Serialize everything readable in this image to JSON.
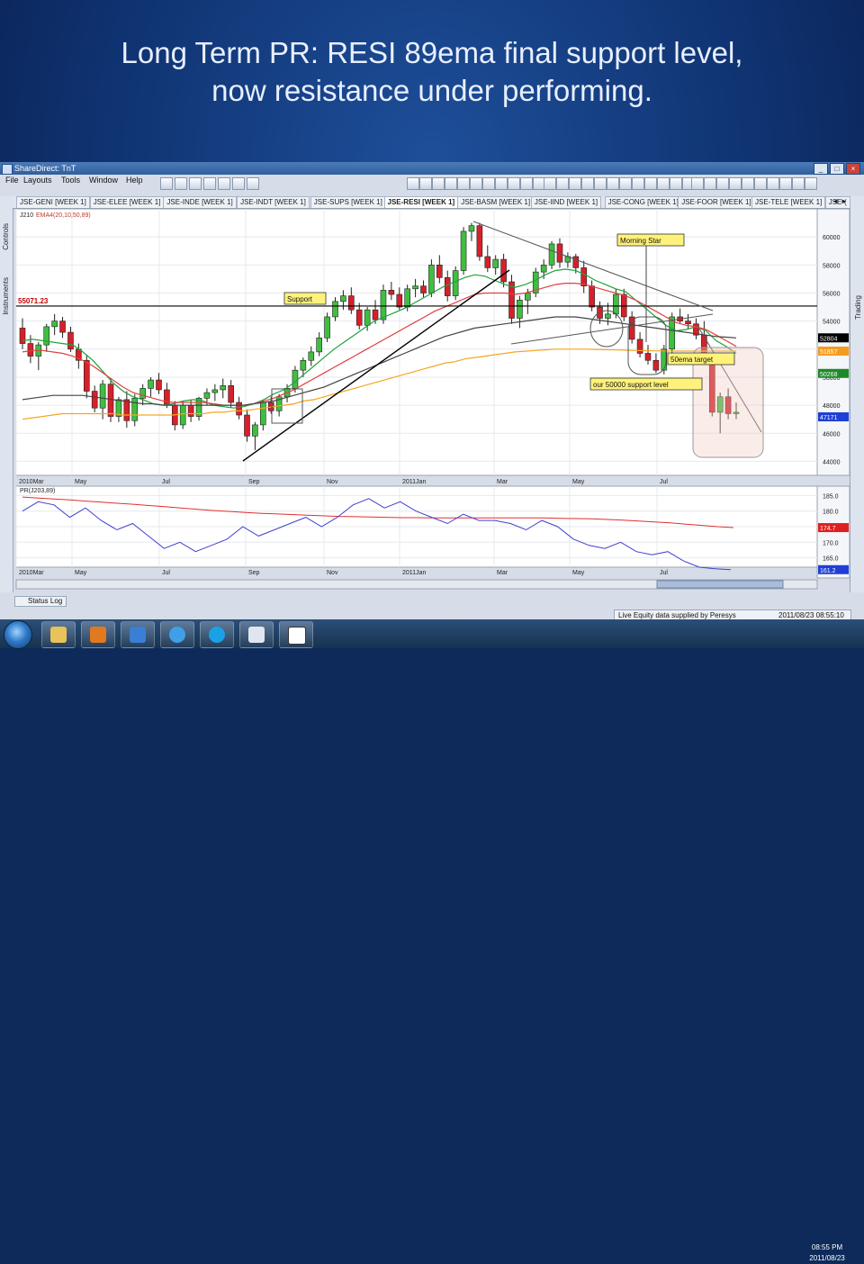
{
  "slide": {
    "title_line1": "Long Term PR: RESI 89ema final support level,",
    "title_line2": "now resistance under performing."
  },
  "app": {
    "title": "ShareDirect: TnT",
    "menu": [
      "File",
      "Layouts",
      "Tools",
      "Window",
      "Help"
    ],
    "left_panels": [
      "Controls",
      "Instruments"
    ],
    "right_panels": [
      "Trading"
    ],
    "tabs": [
      "JSE-GENI [WEEK 1]",
      "JSE-ELEE [WEEK 1]",
      "JSE-INDE [WEEK 1]",
      "JSE-INDT [WEEK 1]",
      "JSE-SUPS [WEEK 1]",
      "JSE-RESI [WEEK 1]",
      "JSE-BASM [WEEK 1]",
      "JSE-IIND [WEEK 1]",
      "JSE-CONG [WEEK 1]",
      "JSE-FOOR [WEEK 1]",
      "JSE-TELE [WEEK 1]",
      "JSE-("
    ],
    "active_tab_index": 5,
    "status_log": "Status Log",
    "data_supplier": "Live Equity data supplied by Peresys",
    "data_timestamp": "2011/08/23 08:55:10 PM",
    "clock_time": "08:55 PM",
    "clock_date": "2011/08/23"
  },
  "chart_data": [
    {
      "type": "candlestick",
      "symbol_label": "J210",
      "indicator_label": "EMA4(20,10,50,89)",
      "y_ticks": [
        60000,
        58000,
        56000,
        54000,
        52000,
        50000,
        48000,
        46000,
        44000
      ],
      "x_ticks": [
        "2010Mar",
        "May",
        "Jul",
        "Sep",
        "Nov",
        "2011Jan",
        "Mar",
        "May",
        "Jul"
      ],
      "ylim": [
        43000,
        62000
      ],
      "horizontal_line": {
        "value": 55071.23,
        "label": "55071.23"
      },
      "price_tags": [
        {
          "value": 52804,
          "label": "52804",
          "color": "#000000"
        },
        {
          "value": 51857,
          "label": "51857",
          "color": "#f59b1e"
        },
        {
          "value": 50268,
          "label": "50268",
          "color": "#1f8a2a"
        },
        {
          "value": 47171,
          "label": "47171",
          "color": "#1f3fd6"
        }
      ],
      "annotations": [
        {
          "text": "Support",
          "x": "Oct 2010",
          "y": 55600
        },
        {
          "text": "Morning Star",
          "x": "Jun 2011",
          "y": 59500
        },
        {
          "text": "50ema target",
          "x": "Jul 2011",
          "y": 50800
        },
        {
          "text": "our 50000 support level",
          "x": "May 2011",
          "y": 49800
        }
      ],
      "candles": [
        [
          53500,
          54200,
          52000,
          52400
        ],
        [
          52400,
          53000,
          51000,
          51500
        ],
        [
          51500,
          52500,
          50500,
          52300
        ],
        [
          52300,
          53800,
          51800,
          53600
        ],
        [
          53600,
          54500,
          53000,
          54000
        ],
        [
          54000,
          54300,
          52800,
          53200
        ],
        [
          53200,
          53600,
          51800,
          52000
        ],
        [
          52000,
          52400,
          50600,
          51200
        ],
        [
          51200,
          51600,
          48500,
          49000
        ],
        [
          49000,
          49400,
          47500,
          47800
        ],
        [
          47800,
          49800,
          47000,
          49500
        ],
        [
          49500,
          49900,
          46800,
          47200
        ],
        [
          47200,
          48600,
          46800,
          48400
        ],
        [
          48400,
          49000,
          46400,
          46900
        ],
        [
          46900,
          48800,
          46500,
          48500
        ],
        [
          48500,
          49500,
          48000,
          49200
        ],
        [
          49200,
          50000,
          48600,
          49800
        ],
        [
          49800,
          50300,
          48800,
          49100
        ],
        [
          49100,
          49600,
          47800,
          48000
        ],
        [
          48000,
          48300,
          46200,
          46600
        ],
        [
          46600,
          48300,
          46300,
          48000
        ],
        [
          48000,
          48400,
          46800,
          47200
        ],
        [
          47200,
          48600,
          46900,
          48500
        ],
        [
          48500,
          49200,
          48000,
          48900
        ],
        [
          48900,
          49500,
          48300,
          49100
        ],
        [
          49100,
          49900,
          48500,
          49400
        ],
        [
          49400,
          49800,
          47800,
          48200
        ],
        [
          48200,
          48600,
          47000,
          47300
        ],
        [
          47300,
          47700,
          45400,
          45800
        ],
        [
          45800,
          46800,
          44800,
          46600
        ],
        [
          46600,
          48400,
          46200,
          48200
        ],
        [
          48200,
          48600,
          47400,
          47600
        ],
        [
          47600,
          48800,
          47200,
          48600
        ],
        [
          48600,
          49500,
          48200,
          49200
        ],
        [
          49200,
          50800,
          48900,
          50500
        ],
        [
          50500,
          51400,
          50000,
          51200
        ],
        [
          51200,
          52200,
          50800,
          51800
        ],
        [
          51800,
          53200,
          51500,
          52800
        ],
        [
          52800,
          54600,
          52500,
          54300
        ],
        [
          54300,
          55700,
          54000,
          55400
        ],
        [
          55400,
          56200,
          54800,
          55800
        ],
        [
          55800,
          56400,
          54500,
          54800
        ],
        [
          54800,
          55300,
          53400,
          53700
        ],
        [
          53700,
          55000,
          53300,
          54800
        ],
        [
          54800,
          55500,
          53800,
          54100
        ],
        [
          54100,
          56600,
          53800,
          56200
        ],
        [
          56200,
          56800,
          55500,
          55900
        ],
        [
          55900,
          56400,
          54800,
          55000
        ],
        [
          55000,
          56600,
          54700,
          56300
        ],
        [
          56300,
          57000,
          55700,
          56500
        ],
        [
          56500,
          56900,
          55700,
          56000
        ],
        [
          56000,
          58400,
          55700,
          58000
        ],
        [
          58000,
          58700,
          56700,
          57100
        ],
        [
          57100,
          57600,
          55400,
          55800
        ],
        [
          55800,
          57900,
          55500,
          57600
        ],
        [
          57600,
          60700,
          57300,
          60400
        ],
        [
          60400,
          61000,
          59700,
          60800
        ],
        [
          60800,
          61000,
          58300,
          58600
        ],
        [
          58600,
          59400,
          57500,
          57800
        ],
        [
          57800,
          58700,
          57300,
          58400
        ],
        [
          58400,
          58800,
          56400,
          56800
        ],
        [
          56800,
          57300,
          53800,
          54200
        ],
        [
          54200,
          55800,
          53500,
          55500
        ],
        [
          55500,
          56300,
          54500,
          56000
        ],
        [
          56000,
          57800,
          55700,
          57500
        ],
        [
          57500,
          58400,
          57000,
          58000
        ],
        [
          58000,
          59700,
          57700,
          59500
        ],
        [
          59500,
          59900,
          57800,
          58200
        ],
        [
          58200,
          58900,
          57800,
          58600
        ],
        [
          58600,
          58800,
          57400,
          57800
        ],
        [
          57800,
          58300,
          56000,
          56500
        ],
        [
          56500,
          56900,
          54700,
          55000
        ],
        [
          55000,
          55400,
          53800,
          54200
        ],
        [
          54200,
          55300,
          53700,
          54500
        ],
        [
          54500,
          56300,
          54200,
          55900
        ],
        [
          55900,
          56300,
          54000,
          54300
        ],
        [
          54300,
          54700,
          52400,
          52700
        ],
        [
          52700,
          53200,
          51400,
          51700
        ],
        [
          51700,
          52300,
          50900,
          51200
        ],
        [
          51200,
          51700,
          50300,
          50500
        ],
        [
          50500,
          52300,
          50200,
          52000
        ],
        [
          52000,
          54600,
          51700,
          54300
        ],
        [
          54300,
          54900,
          53800,
          54000
        ],
        [
          54000,
          54500,
          53400,
          53800
        ],
        [
          53800,
          54200,
          52700,
          53000
        ],
        [
          53000,
          54000,
          51000,
          51300
        ],
        [
          51300,
          51700,
          47200,
          47500
        ],
        [
          47500,
          48900,
          46000,
          48600
        ],
        [
          48600,
          49200,
          47000,
          47400
        ],
        [
          47400,
          48200,
          47000,
          47500
        ]
      ],
      "ema_lines": [
        {
          "name": "EMA 10",
          "color": "#1fa23a",
          "values": [
            52600,
            52700,
            52600,
            52500,
            52400,
            52300,
            51800,
            51200,
            50400,
            49600,
            49000,
            48600,
            48400,
            48100,
            48000,
            48100,
            48300,
            48400,
            48300,
            48000,
            47900,
            47800,
            47900,
            48100,
            48400,
            48800,
            49100,
            49600,
            50200,
            50800,
            51400,
            52000,
            52500,
            53000,
            53500,
            54000,
            54300,
            54600,
            54900,
            55300,
            55700,
            56100,
            56500,
            56800,
            57100,
            57300,
            57200,
            56900,
            56600,
            56400,
            56600,
            56900,
            57300,
            57600,
            57700,
            57600,
            57300,
            56900,
            56600,
            56300,
            56100,
            55500,
            54900,
            54300,
            53700,
            53300,
            53400,
            53600,
            53300,
            52600,
            52200,
            51700
          ]
        },
        {
          "name": "EMA 20",
          "color": "#e04040",
          "values": [
            51800,
            51900,
            51900,
            51800,
            51700,
            51500,
            51200,
            50800,
            50300,
            49800,
            49300,
            48900,
            48700,
            48500,
            48300,
            48200,
            48200,
            48200,
            48200,
            48100,
            48000,
            48000,
            48000,
            48100,
            48300,
            48500,
            48800,
            49100,
            49500,
            49900,
            50300,
            50700,
            51100,
            51500,
            51900,
            52300,
            52700,
            53100,
            53500,
            53900,
            54300,
            54700,
            55000,
            55300,
            55600,
            55900,
            56000,
            56000,
            56000,
            55900,
            56000,
            56200,
            56400,
            56600,
            56700,
            56700,
            56600,
            56400,
            56200,
            56000,
            55800,
            55500,
            55100,
            54700,
            54300,
            53900,
            53700,
            53600,
            53400,
            53000,
            52600,
            52200
          ]
        },
        {
          "name": "EMA 50",
          "color": "#444444",
          "values": [
            48400,
            48500,
            48600,
            48700,
            48700,
            48700,
            48700,
            48600,
            48500,
            48400,
            48300,
            48200,
            48100,
            48100,
            48000,
            48000,
            48000,
            48000,
            48000,
            48000,
            48000,
            48000,
            48000,
            48100,
            48200,
            48300,
            48500,
            48700,
            48900,
            49100,
            49300,
            49600,
            49900,
            50200,
            50500,
            50800,
            51100,
            51400,
            51700,
            52000,
            52300,
            52600,
            52900,
            53100,
            53300,
            53500,
            53600,
            53700,
            53800,
            53900,
            54000,
            54100,
            54200,
            54300,
            54300,
            54300,
            54200,
            54100,
            54000,
            53900,
            53800,
            53700,
            53600,
            53500,
            53400,
            53300,
            53200,
            53100,
            53000,
            52900,
            52850,
            52804
          ]
        },
        {
          "name": "EMA 89",
          "color": "#f5a623",
          "values": [
            47000,
            47100,
            47200,
            47300,
            47400,
            47400,
            47400,
            47400,
            47400,
            47400,
            47300,
            47300,
            47300,
            47300,
            47300,
            47300,
            47400,
            47400,
            47400,
            47500,
            47500,
            47600,
            47600,
            47700,
            47800,
            47900,
            48000,
            48100,
            48300,
            48400,
            48600,
            48800,
            49000,
            49200,
            49400,
            49600,
            49800,
            50000,
            50200,
            50400,
            50600,
            50800,
            51000,
            51100,
            51300,
            51400,
            51500,
            51600,
            51700,
            51800,
            51850,
            51900,
            51950,
            52000,
            52000,
            52000,
            52000,
            51980,
            51960,
            51940,
            51920,
            51900,
            51890,
            51880,
            51870,
            51860,
            51860,
            51858,
            51857,
            51857,
            51857,
            51857
          ]
        }
      ]
    },
    {
      "type": "line",
      "indicator_label": "PR(J203,89)",
      "y_ticks": [
        185.0,
        180.0,
        175.0,
        170.0,
        165.0
      ],
      "ylim": [
        162,
        188
      ],
      "x_ticks": [
        "2010Mar",
        "May",
        "Jul",
        "Sep",
        "Nov",
        "2011Jan",
        "Mar",
        "May",
        "Jul"
      ],
      "price_tags": [
        {
          "value": 174.7,
          "label": "174.7",
          "color": "#e02020"
        },
        {
          "value": 161.2,
          "label": "161.2",
          "color": "#1f3fd6"
        }
      ],
      "series": [
        {
          "name": "",
          "color": "#e03030",
          "values": [
            184.5,
            184.2,
            183.9,
            183.6,
            183.2,
            182.9,
            182.5,
            182.2,
            181.8,
            181.4,
            181.0,
            180.6,
            180.2,
            179.9,
            179.6,
            179.3,
            179.1,
            178.9,
            178.7,
            178.5,
            178.3,
            178.2,
            178.1,
            178.0,
            177.9,
            177.9,
            177.8,
            177.8,
            177.8,
            177.8,
            177.8,
            177.8,
            177.8,
            177.8,
            177.7,
            177.6,
            177.5,
            177.3,
            177.1,
            176.8,
            176.5,
            176.2,
            175.8,
            175.4,
            175.0,
            174.7
          ]
        },
        {
          "name": "",
          "color": "#4040d0",
          "values": [
            180,
            183,
            182,
            178,
            181,
            177,
            174,
            176,
            172,
            168,
            170,
            167,
            169,
            171,
            175,
            172,
            174,
            176,
            178,
            175,
            178,
            182,
            184,
            181,
            183,
            180,
            178,
            176,
            179,
            177,
            177,
            176,
            174,
            177,
            175,
            171,
            169,
            168,
            170,
            167,
            166,
            167,
            164,
            162,
            161.5,
            161.2
          ]
        }
      ]
    }
  ]
}
